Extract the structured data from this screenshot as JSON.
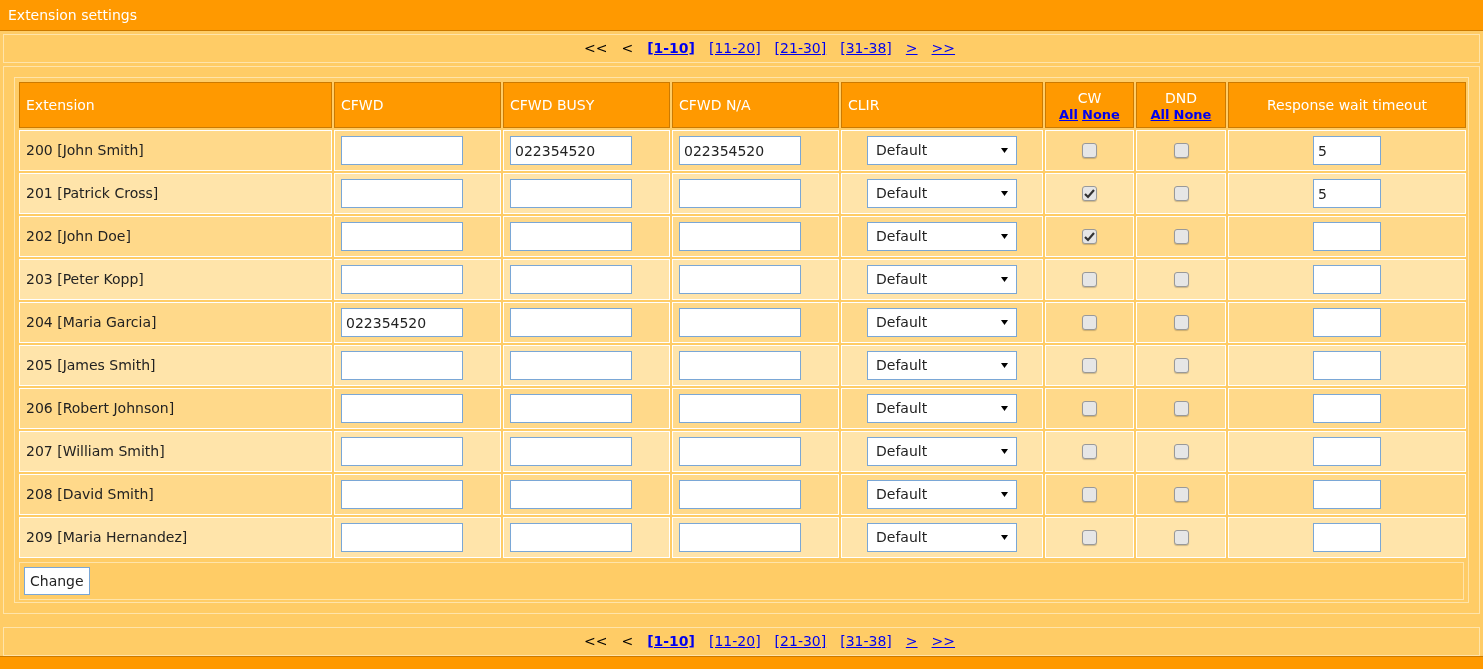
{
  "title": "Extension settings",
  "pager_top": [
    {
      "label": "<<",
      "kind": "text",
      "selected": false
    },
    {
      "label": "<",
      "kind": "text",
      "selected": false
    },
    {
      "label": "[1-10]",
      "kind": "link",
      "selected": true
    },
    {
      "label": "[11-20]",
      "kind": "link",
      "selected": false
    },
    {
      "label": "[21-30]",
      "kind": "link",
      "selected": false
    },
    {
      "label": "[31-38]",
      "kind": "link",
      "selected": false
    },
    {
      "label": ">",
      "kind": "link",
      "selected": false
    },
    {
      "label": ">>",
      "kind": "link",
      "selected": false
    }
  ],
  "table": {
    "columns": [
      {
        "label": "Extension"
      },
      {
        "label": "CFWD"
      },
      {
        "label": "CFWD BUSY"
      },
      {
        "label": "CFWD N/A"
      },
      {
        "label": "CLIR"
      },
      {
        "label": "CW",
        "links": [
          "All",
          "None"
        ]
      },
      {
        "label": "DND",
        "links": [
          "All",
          "None"
        ]
      },
      {
        "label": "Response wait timeout"
      }
    ],
    "rows": [
      {
        "extension": "200 [John Smith]",
        "cfwd": "",
        "cfwd_busy": "022354520",
        "cfwd_na": "022354520",
        "clir": "Default",
        "cw": false,
        "dnd": false,
        "timeout": "5"
      },
      {
        "extension": "201 [Patrick Cross]",
        "cfwd": "",
        "cfwd_busy": "",
        "cfwd_na": "",
        "clir": "Default",
        "cw": true,
        "dnd": false,
        "timeout": "5"
      },
      {
        "extension": "202 [John Doe]",
        "cfwd": "",
        "cfwd_busy": "",
        "cfwd_na": "",
        "clir": "Default",
        "cw": true,
        "dnd": false,
        "timeout": ""
      },
      {
        "extension": "203 [Peter Kopp]",
        "cfwd": "",
        "cfwd_busy": "",
        "cfwd_na": "",
        "clir": "Default",
        "cw": false,
        "dnd": false,
        "timeout": ""
      },
      {
        "extension": "204 [Maria Garcia]",
        "cfwd": "022354520",
        "cfwd_busy": "",
        "cfwd_na": "",
        "clir": "Default",
        "cw": false,
        "dnd": false,
        "timeout": ""
      },
      {
        "extension": "205 [James Smith]",
        "cfwd": "",
        "cfwd_busy": "",
        "cfwd_na": "",
        "clir": "Default",
        "cw": false,
        "dnd": false,
        "timeout": ""
      },
      {
        "extension": "206 [Robert Johnson]",
        "cfwd": "",
        "cfwd_busy": "",
        "cfwd_na": "",
        "clir": "Default",
        "cw": false,
        "dnd": false,
        "timeout": ""
      },
      {
        "extension": "207 [William Smith]",
        "cfwd": "",
        "cfwd_busy": "",
        "cfwd_na": "",
        "clir": "Default",
        "cw": false,
        "dnd": false,
        "timeout": ""
      },
      {
        "extension": "208 [David Smith]",
        "cfwd": "",
        "cfwd_busy": "",
        "cfwd_na": "",
        "clir": "Default",
        "cw": false,
        "dnd": false,
        "timeout": ""
      },
      {
        "extension": "209 [Maria Hernandez]",
        "cfwd": "",
        "cfwd_busy": "",
        "cfwd_na": "",
        "clir": "Default",
        "cw": false,
        "dnd": false,
        "timeout": ""
      }
    ]
  },
  "button": "Change",
  "pager_bottom": [
    {
      "label": "<<",
      "kind": "text",
      "selected": false
    },
    {
      "label": "<",
      "kind": "text",
      "selected": false
    },
    {
      "label": "[1-10]",
      "kind": "link",
      "selected": true
    },
    {
      "label": "[11-20]",
      "kind": "link",
      "selected": false
    },
    {
      "label": "[21-30]",
      "kind": "link",
      "selected": false
    },
    {
      "label": "[31-38]",
      "kind": "link",
      "selected": false
    },
    {
      "label": ">",
      "kind": "link",
      "selected": false
    },
    {
      "label": ">>",
      "kind": "link",
      "selected": false
    }
  ]
}
